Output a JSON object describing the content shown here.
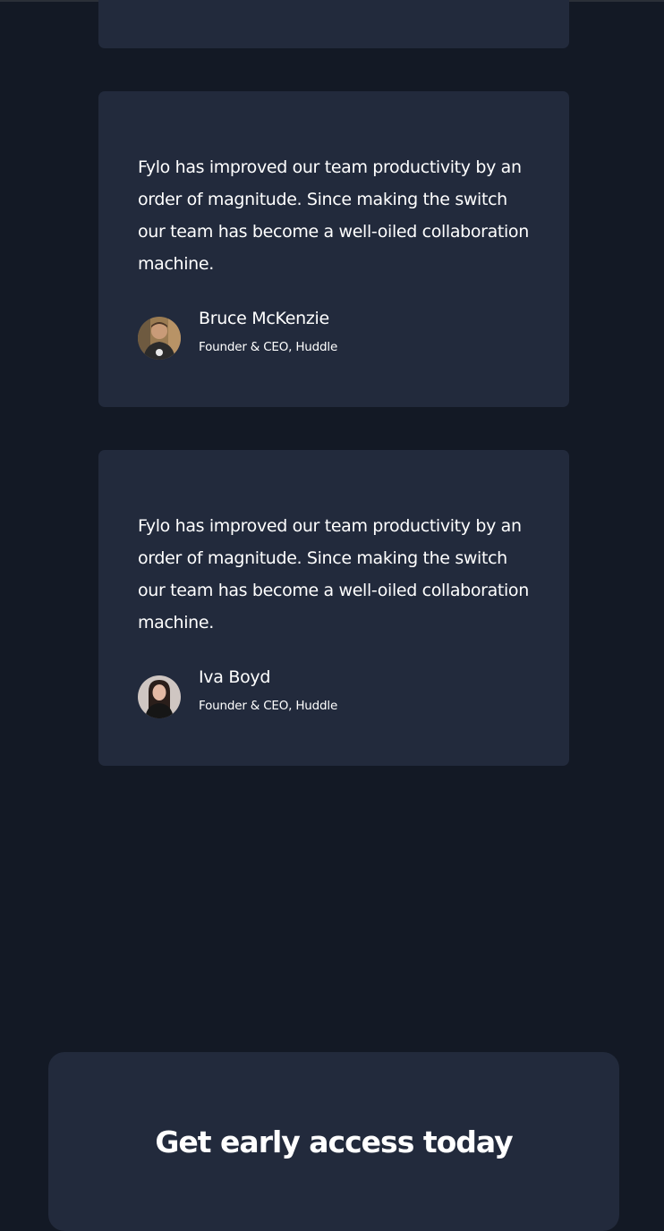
{
  "testimonials": [
    {
      "quote": "Fylo has improved our team productivity by an order of magnitude. Since making the switch our team has become a well-oiled collaboration machine.",
      "name": "Bruce McKenzie",
      "role": "Founder & CEO, Huddle"
    },
    {
      "quote": "Fylo has improved our team productivity by an order of magnitude. Since making the switch our team has become a well-oiled collaboration machine.",
      "name": "Iva Boyd",
      "role": "Founder & CEO, Huddle"
    }
  ],
  "cta": {
    "title": "Get early access today"
  },
  "colors": {
    "page_background": "#131925",
    "card_background": "#222a3c",
    "text": "#ffffff"
  }
}
